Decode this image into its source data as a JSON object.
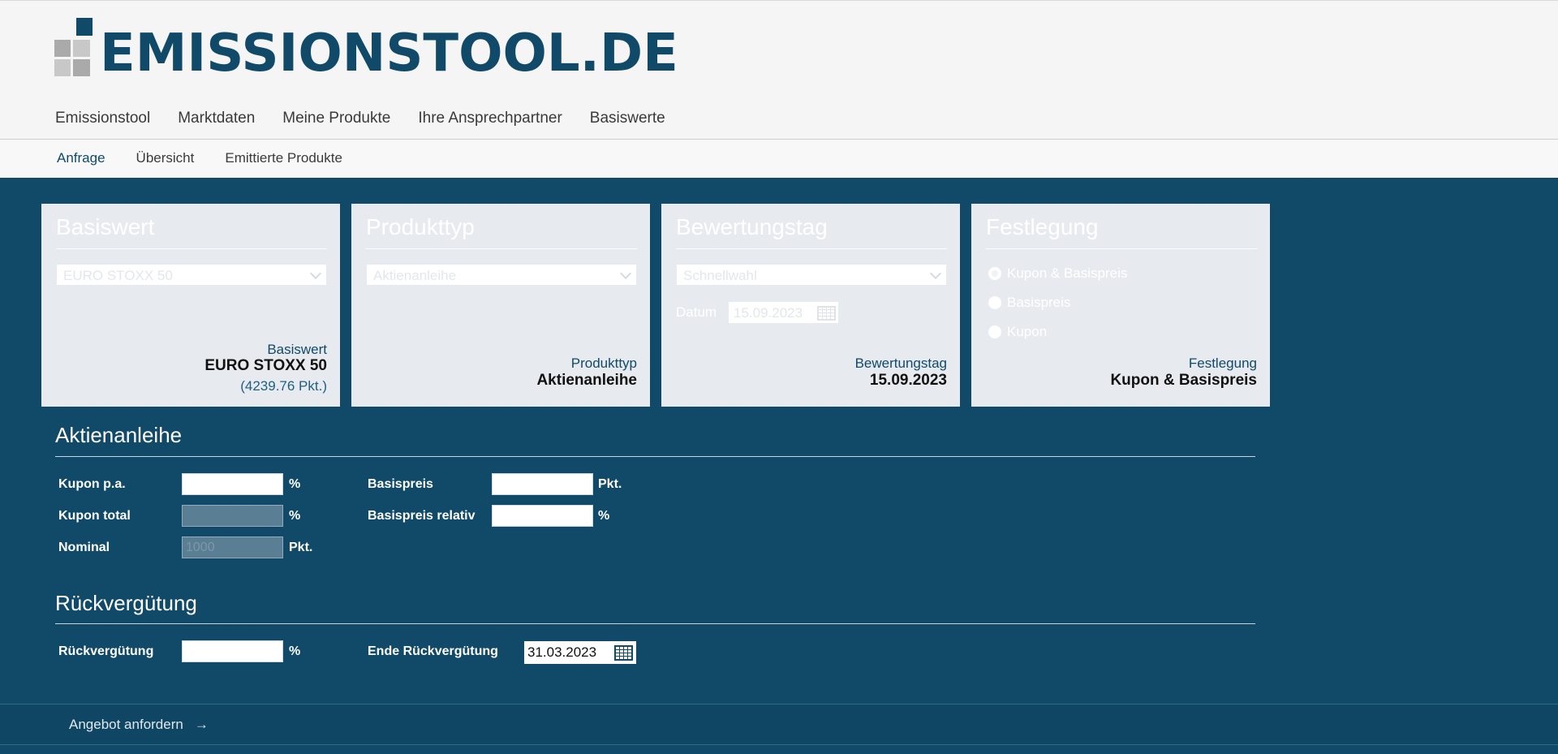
{
  "brand": {
    "logo_text": "EMISSIONSTOOL.DE"
  },
  "main_nav": [
    {
      "label": "Emissionstool"
    },
    {
      "label": "Marktdaten"
    },
    {
      "label": "Meine Produkte"
    },
    {
      "label": "Ihre Ansprechpartner"
    },
    {
      "label": "Basiswerte"
    }
  ],
  "sub_nav": [
    {
      "label": "Anfrage",
      "active": true
    },
    {
      "label": "Übersicht",
      "active": false
    },
    {
      "label": "Emittierte Produkte",
      "active": false
    }
  ],
  "cards": {
    "basiswert": {
      "title": "Basiswert",
      "select_value": "EURO STOXX 50",
      "caption": "Basiswert",
      "value": "EURO STOXX 50",
      "sub": "(4239.76 Pkt.)"
    },
    "produkttyp": {
      "title": "Produkttyp",
      "select_value": "Aktienanleihe",
      "caption": "Produkttyp",
      "value": "Aktienanleihe"
    },
    "bewertungstag": {
      "title": "Bewertungstag",
      "select_value": "Schnellwahl",
      "date_label": "Datum",
      "date_value": "15.09.2023",
      "caption": "Bewertungstag",
      "value": "15.09.2023"
    },
    "festlegung": {
      "title": "Festlegung",
      "options": [
        "Kupon & Basispreis",
        "Basispreis",
        "Kupon"
      ],
      "selected": "Kupon & Basispreis",
      "caption": "Festlegung",
      "value": "Kupon & Basispreis"
    }
  },
  "aktienanleihe": {
    "title": "Aktienanleihe",
    "kupon_pa": {
      "label": "Kupon p.a.",
      "value": "",
      "unit": "%"
    },
    "kupon_total": {
      "label": "Kupon total",
      "value": "",
      "unit": "%"
    },
    "nominal": {
      "label": "Nominal",
      "value": "1000",
      "unit": "Pkt."
    },
    "basispreis": {
      "label": "Basispreis",
      "value": "",
      "unit": "Pkt."
    },
    "basispreis_relativ": {
      "label": "Basispreis relativ",
      "value": "",
      "unit": "%"
    }
  },
  "rueckverguetung": {
    "title": "Rückvergütung",
    "field": {
      "label": "Rückvergütung",
      "value": "",
      "unit": "%"
    },
    "ende": {
      "label": "Ende Rückvergütung",
      "value": "31.03.2023"
    }
  },
  "footer": {
    "cta_label": "Angebot anfordern",
    "cta_arrow": "→"
  },
  "colors": {
    "primary": "#104a68",
    "card_bg": "#e7ebef",
    "header_bg": "#f5f5f5"
  },
  "icons": {
    "calendar": "calendar-icon",
    "dropdown": "chevron-down-icon"
  }
}
